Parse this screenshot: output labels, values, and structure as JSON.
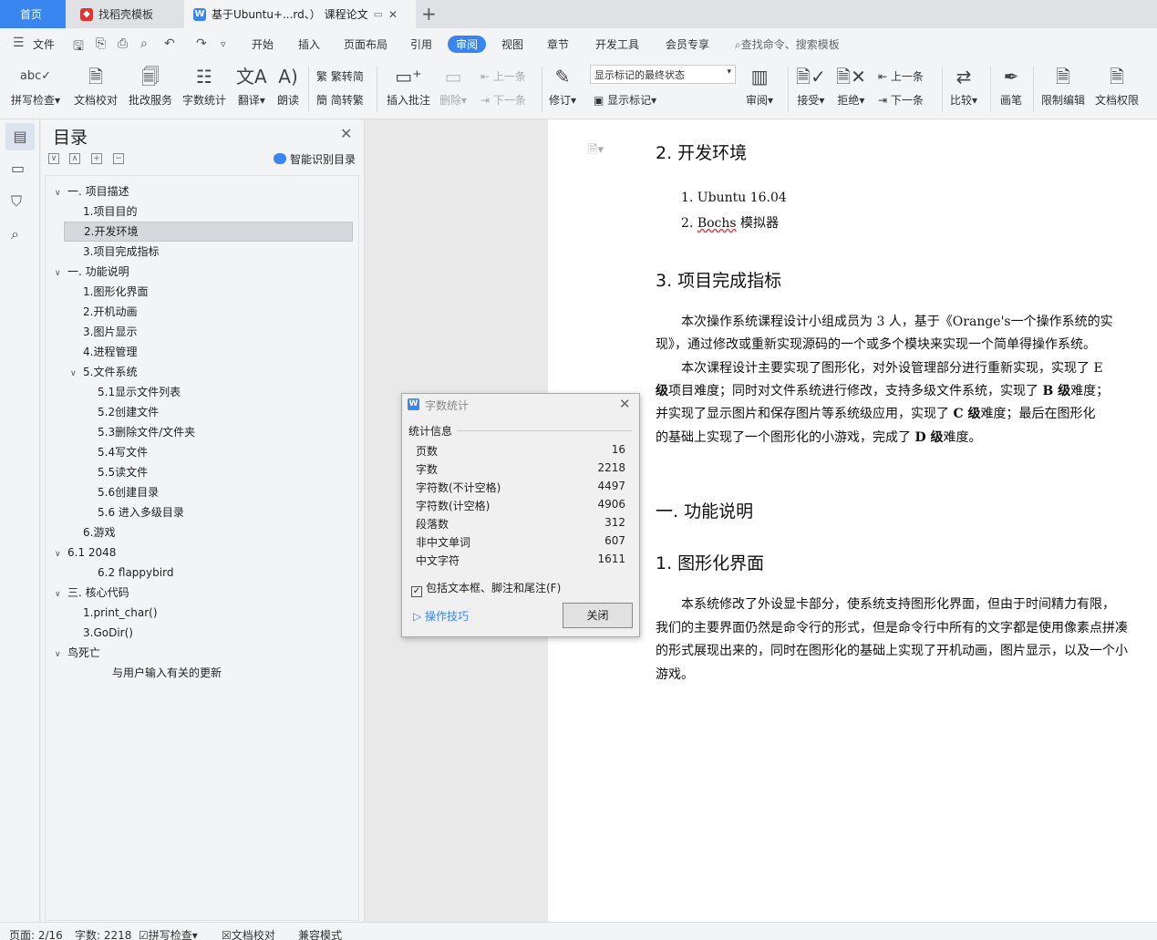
{
  "tabs": {
    "home": "首页",
    "templates": "找稻壳模板",
    "document": "基于Ubuntu+...rd、）  课程论文",
    "doc_badge": "W"
  },
  "menu": {
    "file": "文件",
    "items": [
      "开始",
      "插入",
      "页面布局",
      "引用",
      "审阅",
      "视图",
      "章节",
      "开发工具",
      "会员专享"
    ],
    "active": "审阅",
    "search_placeholder": "查找命令、搜索模板"
  },
  "ribbon": {
    "spellcheck": "拼写检查",
    "doc_check": "文档校对",
    "review_service": "批改服务",
    "word_count": "字数统计",
    "translate": "翻译",
    "read_aloud": "朗读",
    "trad_to_simp": "繁转简",
    "simp_to_trad": "简转繁",
    "insert_comment": "插入批注",
    "delete": "删除",
    "prev_comment": "上一条",
    "next_comment": "下一条",
    "track_changes": "修订",
    "markup_combo": "显示标记的最终状态",
    "show_markup": "显示标记",
    "review_pane": "审阅",
    "accept": "接受",
    "reject": "拒绝",
    "prev_change": "上一条",
    "next_change": "下一条",
    "compare": "比较",
    "ink": "画笔",
    "restrict_edit": "限制编辑",
    "doc_permission": "文档权限"
  },
  "toc": {
    "title": "目录",
    "smart_toc": "智能识别目录",
    "items": [
      "一. 项目描述",
      "1.项目目的",
      "2.开发环境",
      "3.项目完成指标",
      "一. 功能说明",
      "1.图形化界面",
      "2.开机动画",
      "3.图片显示",
      "4.进程管理",
      "5.文件系统",
      "5.1显示文件列表",
      "5.2创建文件",
      "5.3删除文件/文件夹",
      "5.4写文件",
      "5.5读文件",
      "5.6创建目录",
      "5.6 进入多级目录",
      "6.游戏",
      "6.1 2048",
      "6.2 flappybird",
      "三. 核心代码",
      "1.print_char()",
      "3.GoDir()",
      "鸟死亡",
      "与用户输入有关的更新"
    ],
    "selected": "2.开发环境"
  },
  "document": {
    "h_env": "2.  开发环境",
    "env_1": "1.  Ubuntu 16.04",
    "env_2_num": "2.  ",
    "env_2_word": "Bochs",
    "env_2_rest": " 模拟器",
    "h_goals": "3.  项目完成指标",
    "p1_l1": "本次操作系统课程设计小组成员为 3 人，基于《Orange's一个操作系统的实",
    "p1_l2": "现》，通过修改或重新实现源码的一个或多个模块来实现一个简单得操作系统。",
    "p2_l1": "本次课程设计主要实现了图形化，对外设管理部分进行重新实现，实现了 E",
    "p2_l2_a": "级",
    "p2_l2_b": "项目难度；同时对文件系统进行修改，支持多级文件系统，实现了 ",
    "p2_l2_c": "B 级",
    "p2_l2_d": "难度；",
    "p2_l3_a": "并实现了显示图片和保存图片等系统级应用，实现了 ",
    "p2_l3_b": "C 级",
    "p2_l3_c": "难度；最后在图形化",
    "p2_l4_a": "的基础上实现了一个图形化的小游戏，完成了 ",
    "p2_l4_b": "D 级",
    "p2_l4_c": "难度。",
    "h_features": "一. 功能说明",
    "h_gui": "1.  图形化界面",
    "p3_l1": "本系统修改了外设显卡部分，使系统支持图形化界面，但由于时间精力有限，",
    "p3_l2": "我们的主要界面仍然是命令行的形式，但是命令行中所有的文字都是使用像素点拼凑",
    "p3_l3": "的形式展现出来的，同时在图形化的基础上实现了开机动画，图片显示，以及一个小",
    "p3_l4": "游戏。"
  },
  "dialog": {
    "title": "字数统计",
    "section": "统计信息",
    "rows": [
      {
        "label": "页数",
        "value": "16"
      },
      {
        "label": "字数",
        "value": "2218"
      },
      {
        "label": "字符数(不计空格)",
        "value": "4497"
      },
      {
        "label": "字符数(计空格)",
        "value": "4906"
      },
      {
        "label": "段落数",
        "value": "312"
      },
      {
        "label": "非中文单词",
        "value": "607"
      },
      {
        "label": "中文字符",
        "value": "1611"
      }
    ],
    "include_checkbox": "包括文本框、脚注和尾注(F)",
    "include_checked": true,
    "tips": "操作技巧",
    "close": "关闭"
  },
  "status": {
    "page": "页面: 2/16",
    "words": "字数: 2218",
    "spellcheck": "拼写检查",
    "doc_check": "文档校对",
    "compat": "兼容模式"
  },
  "colors": {
    "accent": "#3a86f0",
    "spell_error": "#e04040"
  }
}
